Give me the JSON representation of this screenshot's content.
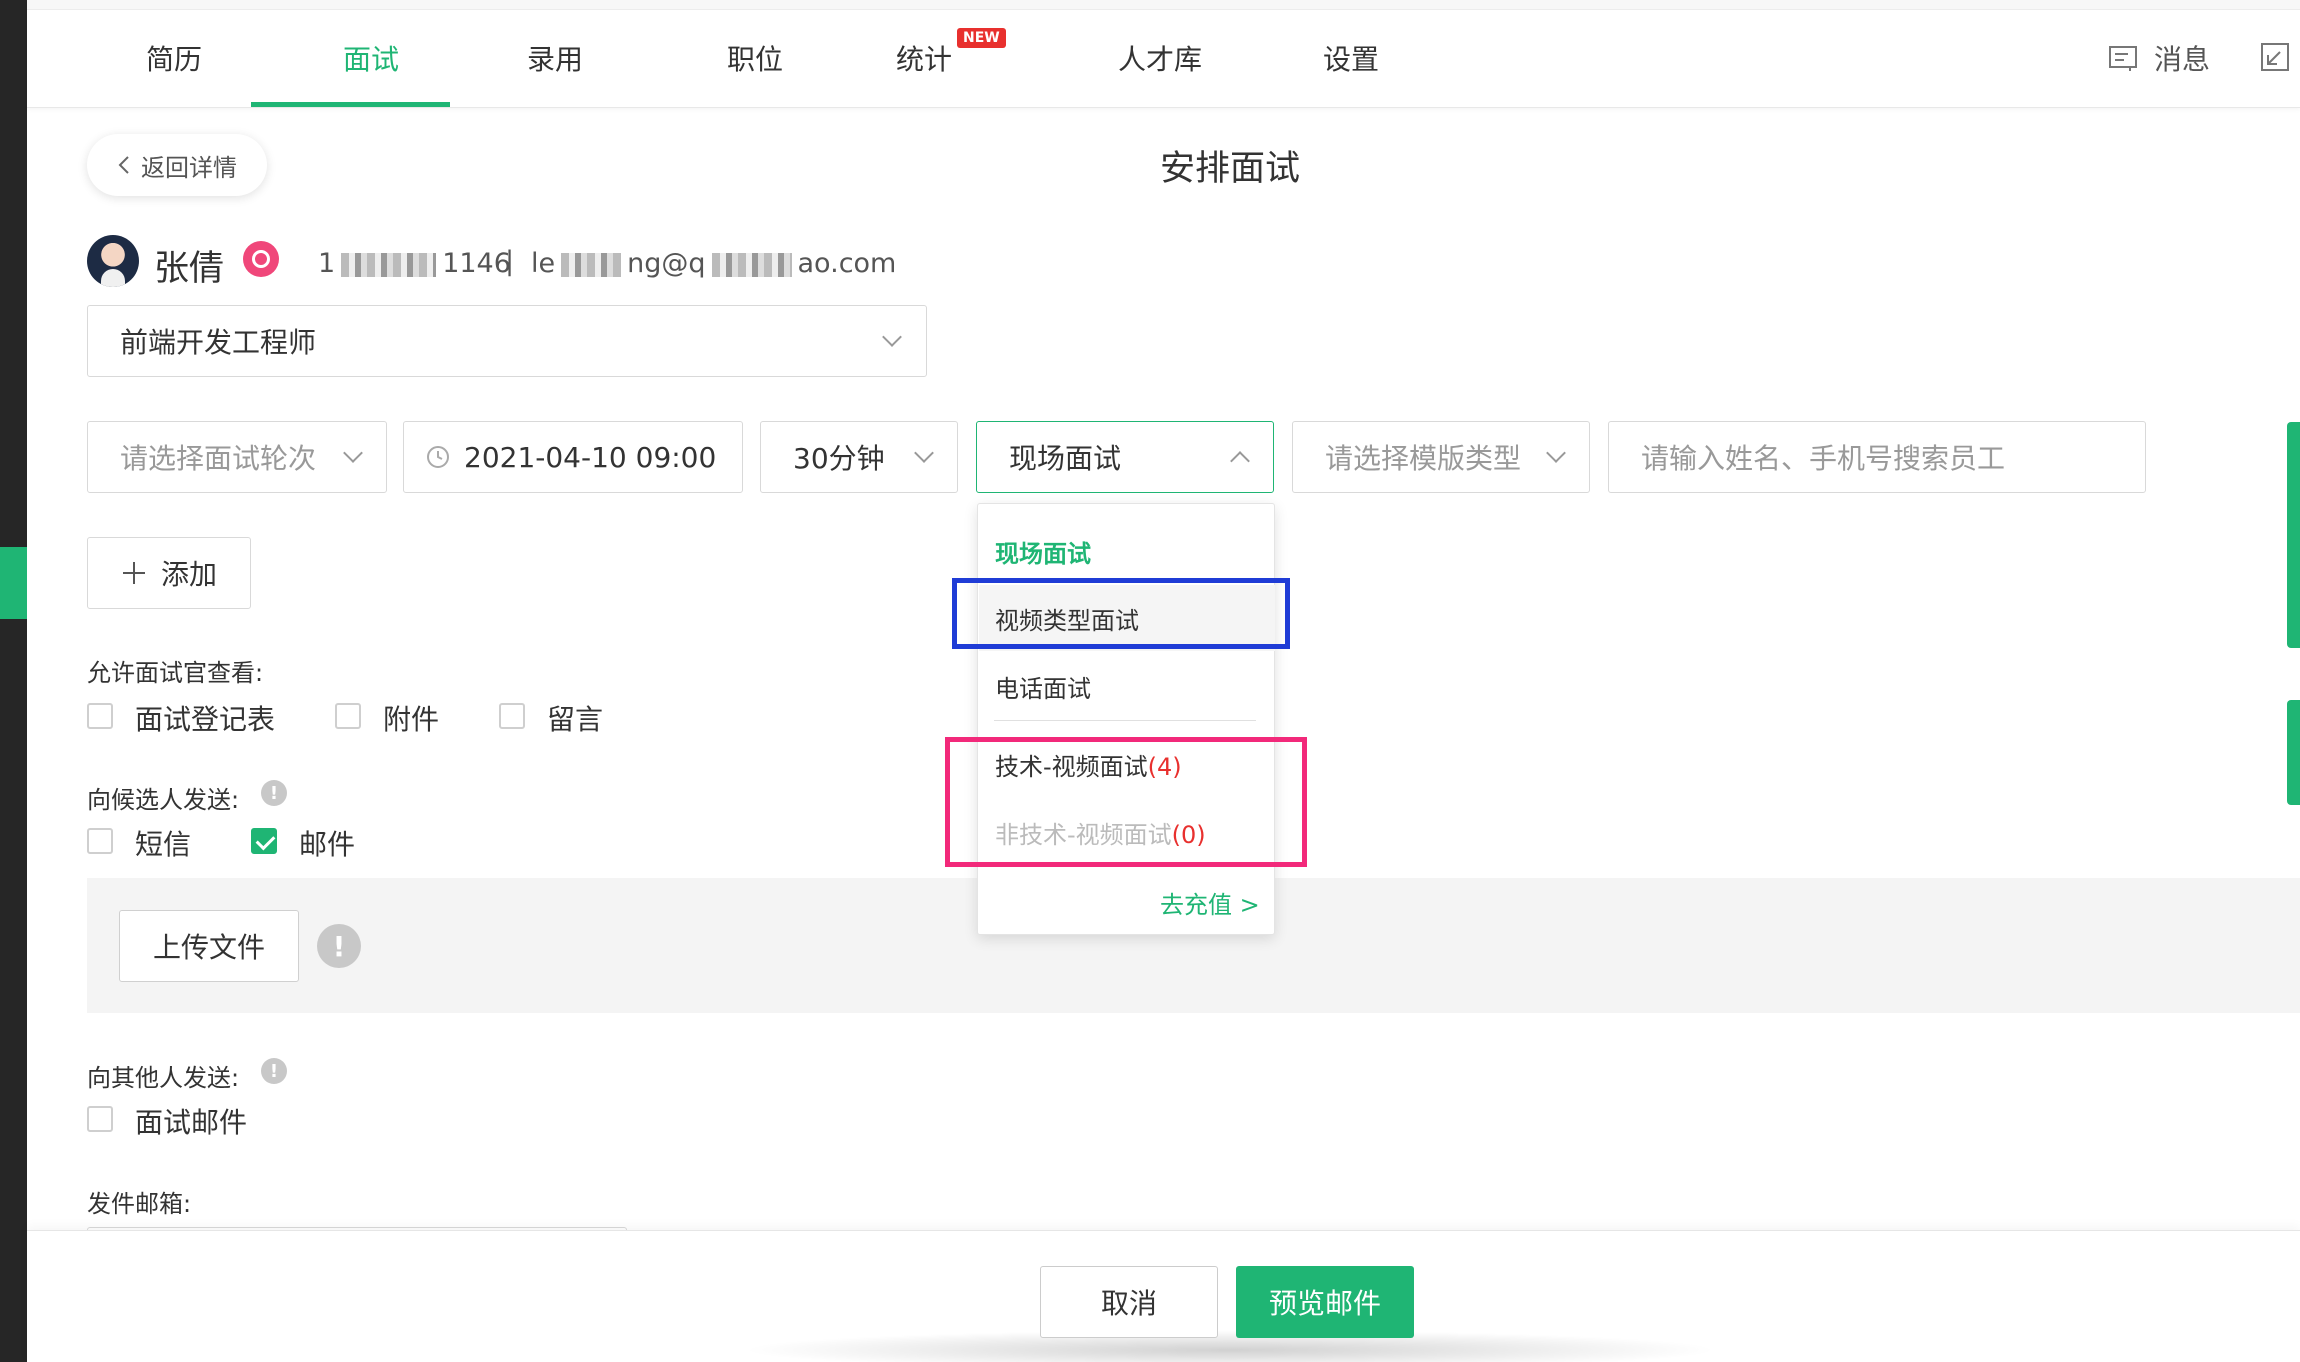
{
  "nav": {
    "items": [
      {
        "label": "简历"
      },
      {
        "label": "面试"
      },
      {
        "label": "录用"
      },
      {
        "label": "职位"
      },
      {
        "label": "统计"
      },
      {
        "label": "人才库"
      },
      {
        "label": "设置"
      }
    ],
    "active_index": 1,
    "new_badge": "NEW",
    "messages_label": "消息"
  },
  "back_label": "返回详情",
  "page_title": "安排面试",
  "candidate": {
    "name": "张倩",
    "phone_prefix": "1",
    "phone_suffix": "1146",
    "separator": "|",
    "email_prefix": "le",
    "email_mid": "ng@q",
    "email_suffix": "ao.com"
  },
  "position_select": {
    "value": "前端开发工程师"
  },
  "fields": {
    "round": {
      "placeholder": "请选择面试轮次"
    },
    "datetime": {
      "value": "2021-04-10 09:00"
    },
    "duration": {
      "value": "30分钟"
    },
    "type": {
      "value": "现场面试"
    },
    "template": {
      "placeholder": "请选择模版类型"
    },
    "staff": {
      "placeholder": "请输入姓名、手机号搜索员工"
    }
  },
  "add_label": "添加",
  "viewer_section": {
    "label": "允许面试官查看:",
    "options": [
      {
        "label": "面试登记表",
        "checked": false
      },
      {
        "label": "附件",
        "checked": false
      },
      {
        "label": "留言",
        "checked": false
      }
    ]
  },
  "send_candidate": {
    "label": "向候选人发送:",
    "options": [
      {
        "label": "短信",
        "checked": false
      },
      {
        "label": "邮件",
        "checked": true
      }
    ]
  },
  "upload_label": "上传文件",
  "send_others": {
    "label": "向其他人发送:",
    "options": [
      {
        "label": "面试邮件",
        "checked": false
      }
    ]
  },
  "mailbox_label": "发件邮箱:",
  "dropdown": {
    "items": [
      {
        "label": "现场面试",
        "state": "selected"
      },
      {
        "label": "视频类型面试",
        "state": "hover"
      },
      {
        "label": "电话面试",
        "state": "normal"
      }
    ],
    "template_items": [
      {
        "label": "技术-视频面试",
        "count": "(4)",
        "state": "normal"
      },
      {
        "label": "非技术-视频面试",
        "count": "(0)",
        "state": "disabled"
      }
    ],
    "recharge_label": "去充值 >"
  },
  "buttons": {
    "cancel": "取消",
    "preview": "预览邮件"
  },
  "colors": {
    "accent": "#1fb574",
    "annotation_blue": "#1f3cd6",
    "annotation_pink": "#f2297a",
    "count_red": "#e8302e"
  }
}
